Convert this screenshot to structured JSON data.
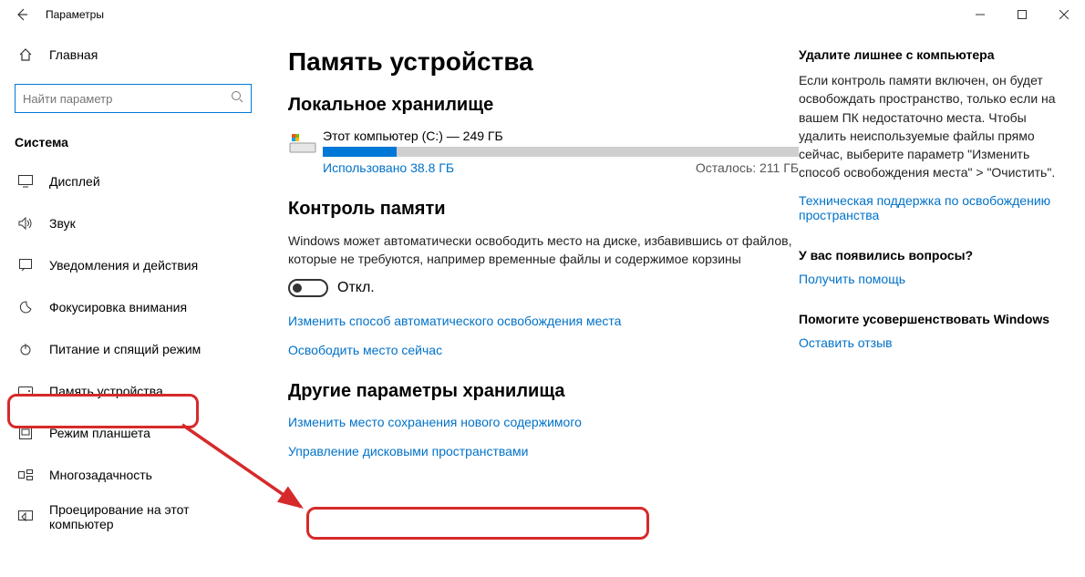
{
  "window": {
    "title": "Параметры"
  },
  "sidebar": {
    "home": "Главная",
    "search_placeholder": "Найти параметр",
    "group": "Система",
    "items": [
      {
        "label": "Дисплей"
      },
      {
        "label": "Звук"
      },
      {
        "label": "Уведомления и действия"
      },
      {
        "label": "Фокусировка внимания"
      },
      {
        "label": "Питание и спящий режим"
      },
      {
        "label": "Память устройства"
      },
      {
        "label": "Режим планшета"
      },
      {
        "label": "Многозадачность"
      },
      {
        "label": "Проецирование на этот компьютер"
      }
    ]
  },
  "main": {
    "h1": "Память устройства",
    "local_h2": "Локальное хранилище",
    "drive": {
      "title": "Этот компьютер (C:) — 249 ГБ",
      "used_label": "Использовано 38.8 ГБ",
      "free_label": "Осталось: 211 ГБ",
      "used_pct": 15.6
    },
    "sense_h2": "Контроль памяти",
    "sense_desc": "Windows может автоматически освободить место на диске, избавившись от файлов, которые не требуются, например временные файлы и содержимое корзины",
    "toggle_label": "Откл.",
    "link_change_auto": "Изменить способ автоматического освобождения места",
    "link_free_now": "Освободить место сейчас",
    "other_h2": "Другие параметры хранилища",
    "link_change_save": "Изменить место сохранения нового содержимого",
    "link_manage_spaces": "Управление дисковыми пространствами"
  },
  "aside": {
    "b1_title": "Удалите лишнее с компьютера",
    "b1_text": "Если контроль памяти включен, он будет освобождать пространство, только если на вашем ПК недостаточно места. Чтобы удалить неиспользуемые файлы прямо сейчас, выберите параметр \"Изменить способ освобождения места\" > \"Очистить\".",
    "b1_link": "Техническая поддержка по освобождению пространства",
    "b2_title": "У вас появились вопросы?",
    "b2_link": "Получить помощь",
    "b3_title": "Помогите усовершенствовать Windows",
    "b3_link": "Оставить отзыв"
  }
}
